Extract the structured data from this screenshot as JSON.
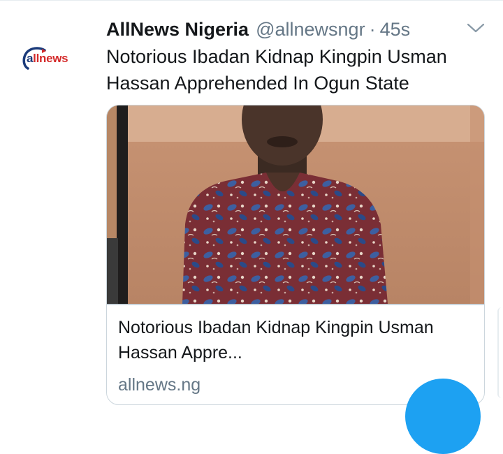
{
  "tweet": {
    "author": {
      "display_name": "AllNews Nigeria",
      "handle": "@allnewsngr",
      "separator": "·",
      "time": "45s",
      "avatar_logo": {
        "text_a": "a",
        "text_rest": "llnews",
        "colors": {
          "blue": "#1a3a7a",
          "red": "#d42a2a"
        }
      }
    },
    "text": "Notorious Ibadan Kidnap Kingpin Usman Hassan Apprehended In Ogun State",
    "menu_icon": "chevron-down-icon",
    "card": {
      "title": "Notorious Ibadan Kidnap Kingpin Usman Hassan Appre...",
      "domain": "allnews.ng"
    }
  },
  "compose_button_icon": "compose-icon",
  "colors": {
    "accent": "#1da1f2",
    "muted": "#657786",
    "text": "#14171a",
    "border": "#ccd6dd"
  }
}
